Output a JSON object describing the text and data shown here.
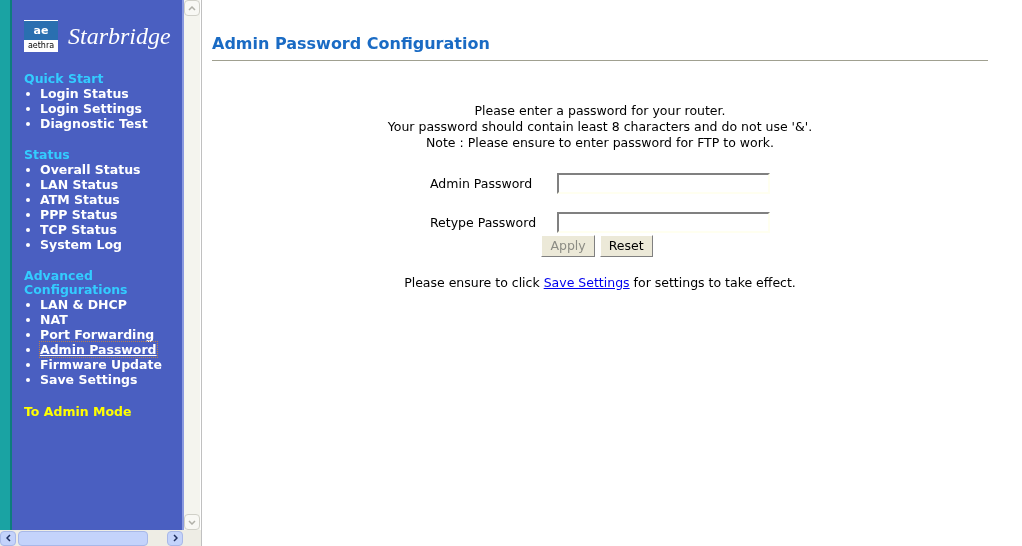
{
  "logo": {
    "mark": "ae",
    "brand": "aethra",
    "product": "Starbridge"
  },
  "sidebar": {
    "sections": [
      {
        "title": "Quick Start",
        "items": [
          {
            "label": "Login Status",
            "selected": false
          },
          {
            "label": "Login Settings",
            "selected": false
          },
          {
            "label": "Diagnostic Test",
            "selected": false
          }
        ]
      },
      {
        "title": "Status",
        "items": [
          {
            "label": "Overall Status",
            "selected": false
          },
          {
            "label": "LAN Status",
            "selected": false
          },
          {
            "label": "ATM Status",
            "selected": false
          },
          {
            "label": "PPP Status",
            "selected": false
          },
          {
            "label": "TCP Status",
            "selected": false
          },
          {
            "label": "System Log",
            "selected": false
          }
        ]
      },
      {
        "title": "Advanced Configurations",
        "items": [
          {
            "label": "LAN & DHCP",
            "selected": false
          },
          {
            "label": "NAT",
            "selected": false
          },
          {
            "label": "Port Forwarding",
            "selected": false
          },
          {
            "label": "Admin Password",
            "selected": true
          },
          {
            "label": "Firmware Update",
            "selected": false
          },
          {
            "label": "Save Settings",
            "selected": false
          }
        ]
      }
    ],
    "mode_link": "To Admin Mode"
  },
  "page": {
    "title": "Admin Password Configuration",
    "intro": [
      "Please enter a password for your router.",
      "Your password should contain least 8 characters and do not use '&'.",
      "Note : Please ensure to enter password for FTP to work."
    ],
    "fields": [
      {
        "label": "Admin Password"
      },
      {
        "label": "Retype Password"
      }
    ],
    "buttons": [
      {
        "label": "Apply",
        "disabled": true
      },
      {
        "label": "Reset",
        "disabled": false
      }
    ],
    "footer": {
      "before": "Please ensure to click ",
      "link": "Save Settings",
      "after": " for settings to take effect."
    }
  }
}
